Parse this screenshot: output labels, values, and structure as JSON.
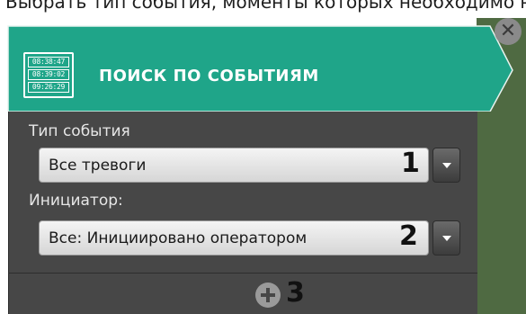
{
  "caption": "Выбрать тип события, моменты которых необходимо найти",
  "header": {
    "title": "ПОИСК ПО СОБЫТИЯМ",
    "clock_lines": [
      "08:38:47",
      "08:39:02",
      "09:26:29"
    ],
    "icon": "clock-list-icon"
  },
  "close_icon_glyph": "✕",
  "event_type": {
    "label": "Тип события",
    "value": "Все тревоги",
    "marker": "1"
  },
  "initiator": {
    "label": "Инициатор:",
    "value": "Все: Инициировано оператором",
    "marker": "2"
  },
  "add": {
    "marker": "3",
    "icon": "plus-circle-icon"
  },
  "colors": {
    "header_green": "#1fa589",
    "panel_dark": "#474747",
    "side_green": "#4f6a42"
  }
}
